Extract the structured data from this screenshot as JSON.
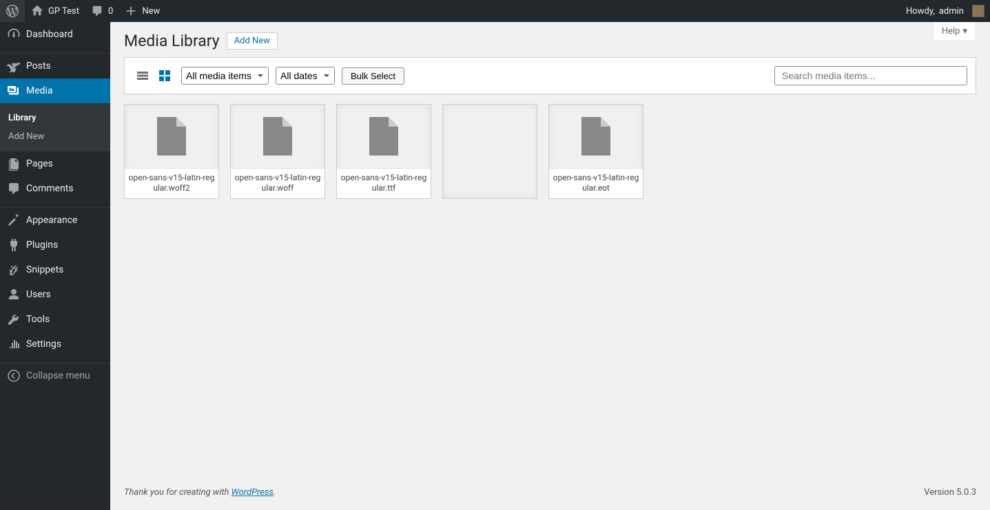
{
  "adminbar": {
    "site_name": "GP Test",
    "comments_count": "0",
    "new_label": "New",
    "howdy_prefix": "Howdy, ",
    "username": "admin"
  },
  "sidebar": {
    "items": [
      {
        "label": "Dashboard",
        "icon": "dashboard"
      },
      {
        "label": "Posts",
        "icon": "pin"
      },
      {
        "label": "Media",
        "icon": "media",
        "current": true
      },
      {
        "label": "Pages",
        "icon": "pages"
      },
      {
        "label": "Comments",
        "icon": "comments"
      },
      {
        "label": "Appearance",
        "icon": "appearance"
      },
      {
        "label": "Plugins",
        "icon": "plugins"
      },
      {
        "label": "Snippets",
        "icon": "snippets"
      },
      {
        "label": "Users",
        "icon": "users"
      },
      {
        "label": "Tools",
        "icon": "tools"
      },
      {
        "label": "Settings",
        "icon": "settings"
      }
    ],
    "submenu": [
      {
        "label": "Library",
        "current": true
      },
      {
        "label": "Add New"
      }
    ],
    "collapse_label": "Collapse menu"
  },
  "page": {
    "title": "Media Library",
    "add_new": "Add New",
    "help_label": "Help"
  },
  "toolbar": {
    "filter_type": "All media items",
    "filter_date": "All dates",
    "bulk_select": "Bulk Select",
    "search_placeholder": "Search media items..."
  },
  "media_items": [
    {
      "filename": "open-sans-v15-latin-regular.woff2"
    },
    {
      "filename": "open-sans-v15-latin-regular.woff"
    },
    {
      "filename": "open-sans-v15-latin-regular.ttf"
    },
    {
      "filename": "",
      "empty": true
    },
    {
      "filename": "open-sans-v15-latin-regular.eot"
    }
  ],
  "footer": {
    "thanks_prefix": "Thank you for creating with ",
    "wordpress_link": "WordPress",
    "thanks_suffix": ".",
    "version": "Version 5.0.3"
  }
}
